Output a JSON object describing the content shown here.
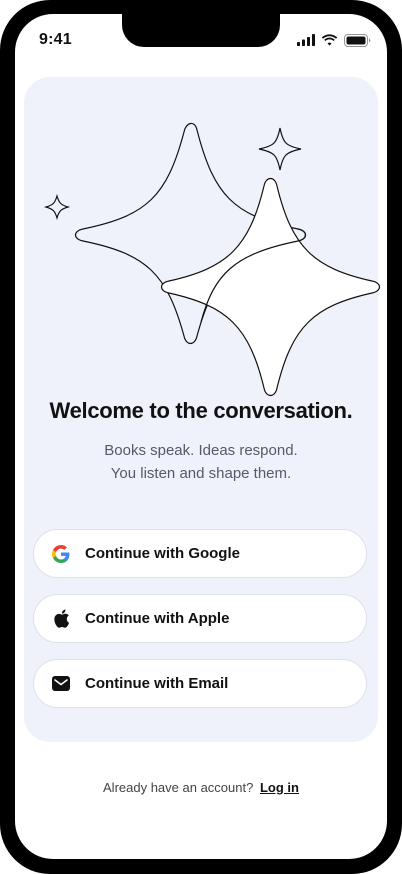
{
  "status_bar": {
    "time": "9:41"
  },
  "welcome": {
    "title": "Welcome to the conversation.",
    "subtitle_line1": "Books speak. Ideas respond.",
    "subtitle_line2": "You listen and shape them."
  },
  "auth_buttons": [
    {
      "label": "Continue with Google",
      "icon": "google-icon"
    },
    {
      "label": "Continue with Apple",
      "icon": "apple-icon"
    },
    {
      "label": "Continue with Email",
      "icon": "email-icon"
    }
  ],
  "footer": {
    "prompt": "Already have an account?",
    "login_label": "Log in"
  },
  "colors": {
    "card_background": "#eff2fa",
    "text_primary": "#111111",
    "text_secondary": "#555a66"
  }
}
